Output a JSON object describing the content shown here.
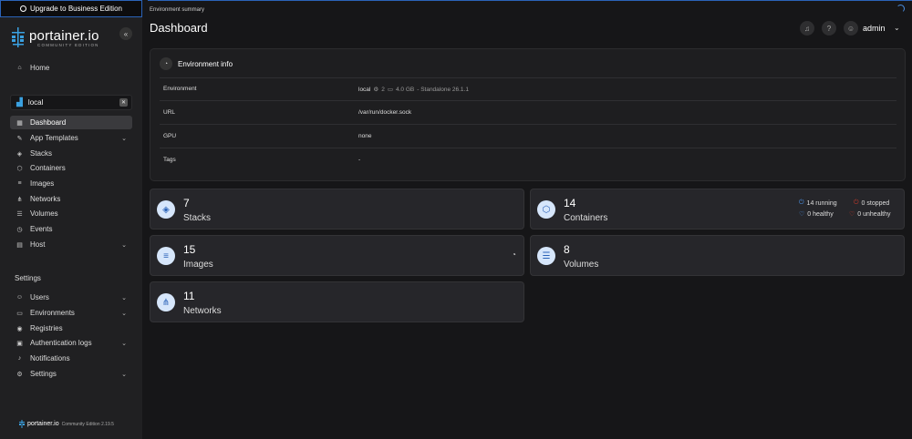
{
  "sidebar": {
    "upgrade_label": "Upgrade to Business Edition",
    "brand_name": "portainer.io",
    "brand_sub": "COMMUNITY EDITION",
    "home": "Home",
    "environment": "local",
    "env_items": [
      {
        "label": "Dashboard",
        "icon": "dashboard-icon"
      },
      {
        "label": "App Templates",
        "icon": "templates-icon"
      },
      {
        "label": "Stacks",
        "icon": "stacks-icon"
      },
      {
        "label": "Containers",
        "icon": "containers-icon"
      },
      {
        "label": "Images",
        "icon": "images-icon"
      },
      {
        "label": "Networks",
        "icon": "networks-icon"
      },
      {
        "label": "Volumes",
        "icon": "volumes-icon"
      },
      {
        "label": "Events",
        "icon": "events-icon"
      },
      {
        "label": "Host",
        "icon": "host-icon"
      }
    ],
    "settings_heading": "Settings",
    "settings_items": [
      {
        "label": "Users",
        "icon": "users-icon"
      },
      {
        "label": "Environments",
        "icon": "environments-icon"
      },
      {
        "label": "Registries",
        "icon": "registries-icon"
      },
      {
        "label": "Authentication logs",
        "icon": "auth-logs-icon"
      },
      {
        "label": "Notifications",
        "icon": "notifications-icon"
      },
      {
        "label": "Settings",
        "icon": "settings-icon"
      }
    ],
    "footer_brand": "portainer.io",
    "footer_version": "Community Edition 2.19.5"
  },
  "header": {
    "breadcrumb": "Environment summary",
    "title": "Dashboard",
    "user": "admin"
  },
  "env_info": {
    "title": "Environment info",
    "rows": [
      {
        "key": "Environment",
        "value": "local",
        "cpu": "2",
        "mem": "4.0 GB",
        "extra": "- Standalone 26.1.1"
      },
      {
        "key": "URL",
        "value": "/var/run/docker.sock"
      },
      {
        "key": "GPU",
        "value": "none"
      },
      {
        "key": "Tags",
        "value": "-"
      }
    ]
  },
  "cards": {
    "stacks": {
      "count": "7",
      "label": "Stacks"
    },
    "containers": {
      "count": "14",
      "label": "Containers",
      "running": "14 running",
      "stopped": "0 stopped",
      "healthy": "0 healthy",
      "unhealthy": "0 unhealthy"
    },
    "images": {
      "count": "15",
      "label": "Images"
    },
    "volumes": {
      "count": "8",
      "label": "Volumes"
    },
    "networks": {
      "count": "11",
      "label": "Networks"
    }
  },
  "colors": {
    "accent": "#2b63b8",
    "icon_bg": "#d6e6fb"
  }
}
